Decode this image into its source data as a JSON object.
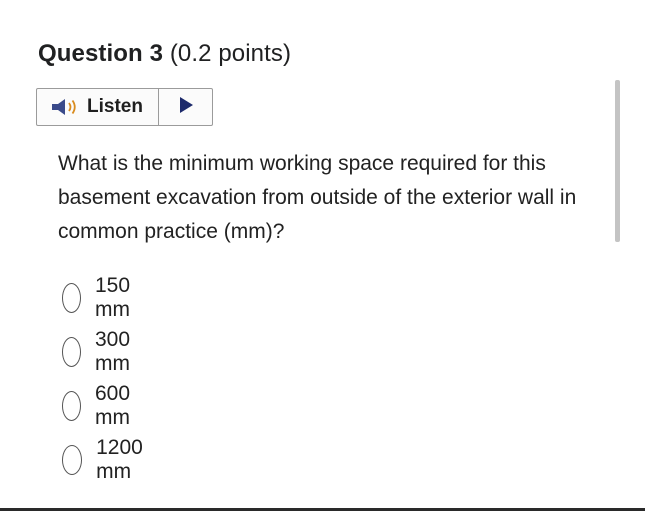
{
  "question": {
    "number_label": "Question 3",
    "points_label": "(0.2 points)",
    "text": "What is the minimum working space required for this basement excavation from outside of the exterior wall in common practice (mm)?"
  },
  "listen": {
    "label": "Listen",
    "speaker_icon": "speaker-icon",
    "play_icon": "play-icon"
  },
  "options": [
    {
      "label": "150 mm",
      "selected": false
    },
    {
      "label": "300 mm",
      "selected": false
    },
    {
      "label": "600 mm",
      "selected": false
    },
    {
      "label": "1200 mm",
      "selected": false
    }
  ],
  "colors": {
    "text": "#222222",
    "border": "#9b9b9b",
    "speaker": "#3a4a8a"
  }
}
